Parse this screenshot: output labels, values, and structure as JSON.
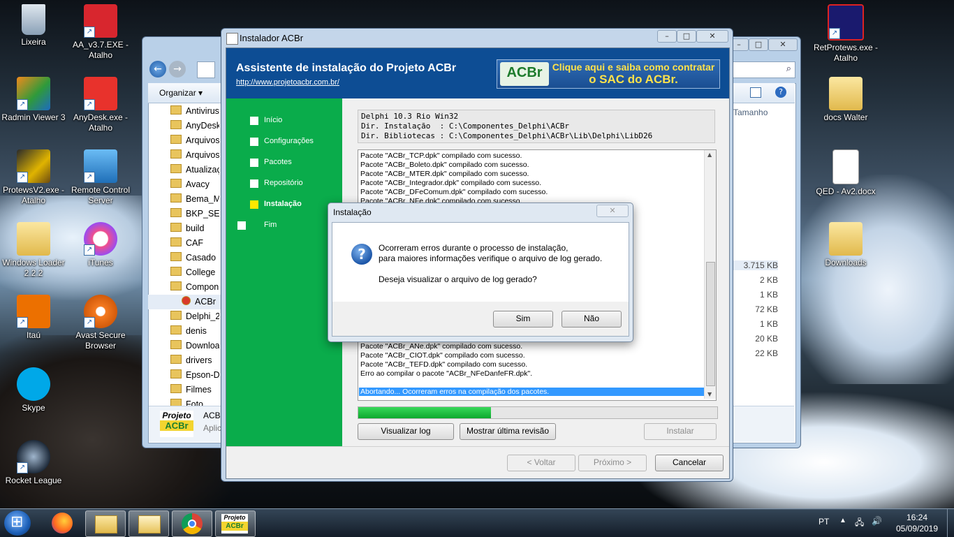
{
  "desktop_icons_left": [
    {
      "label": "Lixeira",
      "icon": "recycle-bin-icon"
    },
    {
      "label": "AA_v3.7.EXE - Atalho",
      "icon": "app-shortcut-icon"
    },
    {
      "label": "Radmin Viewer 3",
      "icon": "radmin-icon"
    },
    {
      "label": "AnyDesk.exe - Atalho",
      "icon": "anydesk-icon"
    },
    {
      "label": "ProtewsV2.exe - Atalho",
      "icon": "protews-icon"
    },
    {
      "label": "Remote Control Server",
      "icon": "remote-control-icon"
    },
    {
      "label": "Windows Loader 2.2.2",
      "icon": "folder-icon"
    },
    {
      "label": "iTunes",
      "icon": "itunes-icon"
    },
    {
      "label": "Itaú",
      "icon": "itau-icon"
    },
    {
      "label": "Avast Secure Browser",
      "icon": "avast-icon"
    },
    {
      "label": "Skype",
      "icon": "skype-icon"
    },
    {
      "label": "Rocket League",
      "icon": "rocket-league-icon"
    }
  ],
  "desktop_icons_right": [
    {
      "label": "RetProtews.exe - Atalho",
      "icon": "app-shortcut-icon"
    },
    {
      "label": "docs Walter",
      "icon": "folder-icon"
    },
    {
      "label": "QED - Av2.docx",
      "icon": "word-doc-icon"
    },
    {
      "label": "Downloads",
      "icon": "folder-icon"
    }
  ],
  "explorer": {
    "organize": "Organizar ▾",
    "column_size": "Tamanho",
    "folders": [
      "Antivirus",
      "AnyDesk",
      "Arquivos",
      "Arquivos",
      "Atualizaç",
      "Avacy",
      "Bema_M",
      "BKP_SER",
      "build",
      "CAF",
      "Casado",
      "College",
      "Compon",
      "ACBr",
      "Delphi_2",
      "denis",
      "Download",
      "drivers",
      "Epson-D",
      "Filmes",
      "Foto"
    ],
    "sizes": [
      "3.715 KB",
      "2 KB",
      "1 KB",
      "72 KB",
      "1 KB",
      "20 KB",
      "22 KB"
    ],
    "bottom_logo_1": "Projeto",
    "bottom_logo_2": "ACBr",
    "bottom_text_1": "ACB",
    "bottom_text_2": "Aplic"
  },
  "installer": {
    "window_title": "Instalador ACBr",
    "header_title": "Assistente de instalação do Projeto ACBr",
    "header_link": "http://www.projetoacbr.com.br/",
    "banner_logo": "ACBr",
    "banner_line1": "Clique aqui e saiba como contratar",
    "banner_line2": "o SAC do ACBr.",
    "steps": [
      {
        "label": "Início",
        "active": false
      },
      {
        "label": "Configurações",
        "active": false
      },
      {
        "label": "Pacotes",
        "active": false
      },
      {
        "label": "Repositório",
        "active": false
      },
      {
        "label": "Instalação",
        "active": true
      },
      {
        "label": "Fim",
        "active": false
      }
    ],
    "info_lines": [
      "Delphi 10.3 Rio Win32",
      "Dir. Instalação  : C:\\Componentes_Delphi\\ACBr",
      "Dir. Bibliotecas : C:\\Componentes_Delphi\\ACBr\\Lib\\Delphi\\LibD26"
    ],
    "log_top": [
      "Pacote \"ACBr_TCP.dpk\" compilado com sucesso.",
      "Pacote \"ACBr_Boleto.dpk\" compilado com sucesso.",
      "Pacote \"ACBr_MTER.dpk\" compilado com sucesso.",
      "Pacote \"ACBr_Integrador.dpk\" compilado com sucesso.",
      "Pacote \"ACBr_DFeComum.dpk\" compilado com sucesso.",
      "Pacote \"ACBr_NFe.dpk\" compilado com sucesso."
    ],
    "log_bottom": [
      "Pacote \"ACBr_ANe.dpk\" compilado com sucesso.",
      "Pacote \"ACBr_CIOT.dpk\" compilado com sucesso.",
      "Pacote \"ACBr_TEFD.dpk\" compilado com sucesso.",
      "Erro ao compilar o pacote \"ACBr_NFeDanfeFR.dpk\"."
    ],
    "log_selected": "Abortando... Ocorreram erros na compilação dos pacotes.",
    "progress_fraction": 0.37,
    "btn_view_log": "Visualizar log",
    "btn_last_revision": "Mostrar última revisão",
    "btn_install": "Instalar",
    "btn_back": "< Voltar",
    "btn_next": "Próximo >",
    "btn_cancel": "Cancelar"
  },
  "dialog": {
    "title": "Instalação",
    "line1": "Ocorreram erros durante o processo de instalação,",
    "line2": "para maiores informações verifique o arquivo de log gerado.",
    "line3": "Deseja visualizar o arquivo de log gerado?",
    "btn_yes": "Sim",
    "btn_no": "Não"
  },
  "taskbar": {
    "language": "PT",
    "time": "16:24",
    "date": "05/09/2019",
    "pinned": [
      "firefox-icon",
      "file-explorer-icon",
      "mail-folder-icon",
      "chrome-icon",
      "projeto-acbr-icon"
    ],
    "acbr_label_1": "Projeto",
    "acbr_label_2": "ACBr"
  }
}
